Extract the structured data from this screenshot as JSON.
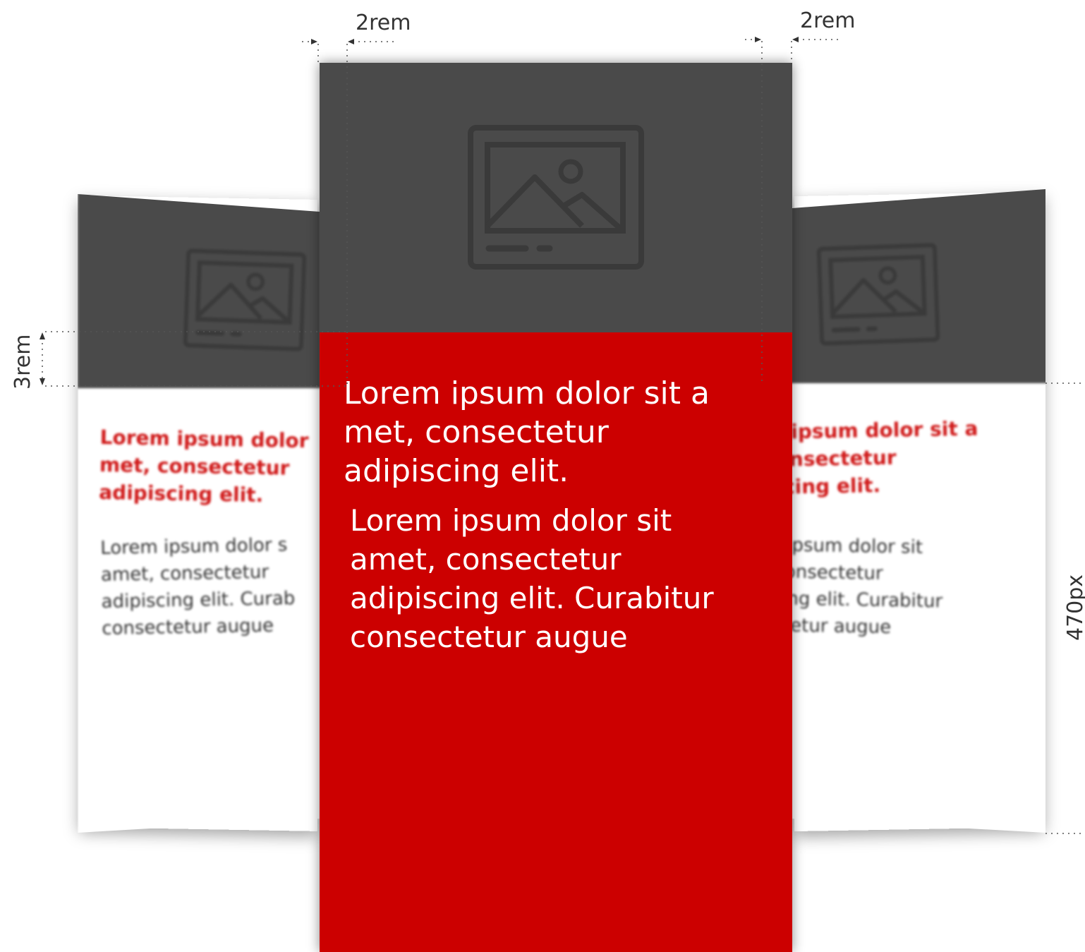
{
  "dimensions": {
    "padding_left_label": "2rem",
    "padding_right_label": "2rem",
    "gap_label": "3rem",
    "height_label": "470px"
  },
  "cards": {
    "left": {
      "title": "Lorem ipsum dolor\nmet, consectetur\nadipiscing elit.",
      "text": "Lorem ipsum dolor s\namet, consectetur\nadipiscing elit. Curab\nconsectetur augue"
    },
    "center": {
      "title": "Lorem ipsum dolor sit a\nmet, consectetur\nadipiscing elit.",
      "text": "Lorem ipsum dolor sit\namet, consectetur\nadipiscing elit. Curabitur\nconsectetur augue"
    },
    "right": {
      "title": "m ipsum dolor sit a\n consectetur\niscing elit.",
      "text": "m ipsum dolor sit\n, consectetur\nscing elit. Curabitur\nectetur augue"
    }
  },
  "colors": {
    "image_placeholder": "#4a4a4a",
    "icon_stroke": "#3a3a3a",
    "accent": "#cc0000",
    "title_red": "#d01a1a"
  },
  "icons": {
    "image_placeholder": "image-icon"
  }
}
